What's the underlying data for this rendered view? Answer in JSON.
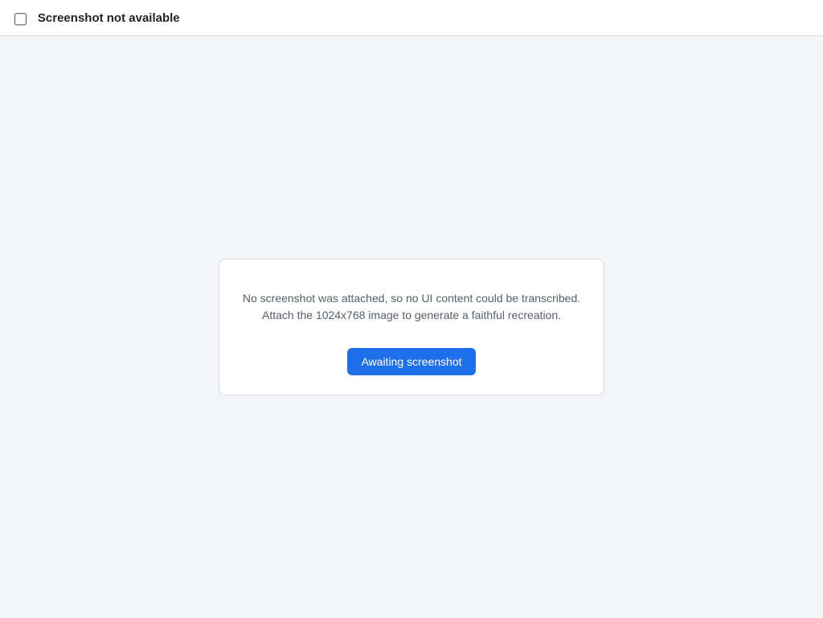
{
  "window": {
    "title": "Screenshot not available"
  },
  "placeholder": {
    "icon": "image-missing-icon",
    "message": "No screenshot was attached, so no UI content could be transcribed. Attach the 1024x768 image to generate a faithful recreation.",
    "action_label": "Awaiting screenshot"
  }
}
